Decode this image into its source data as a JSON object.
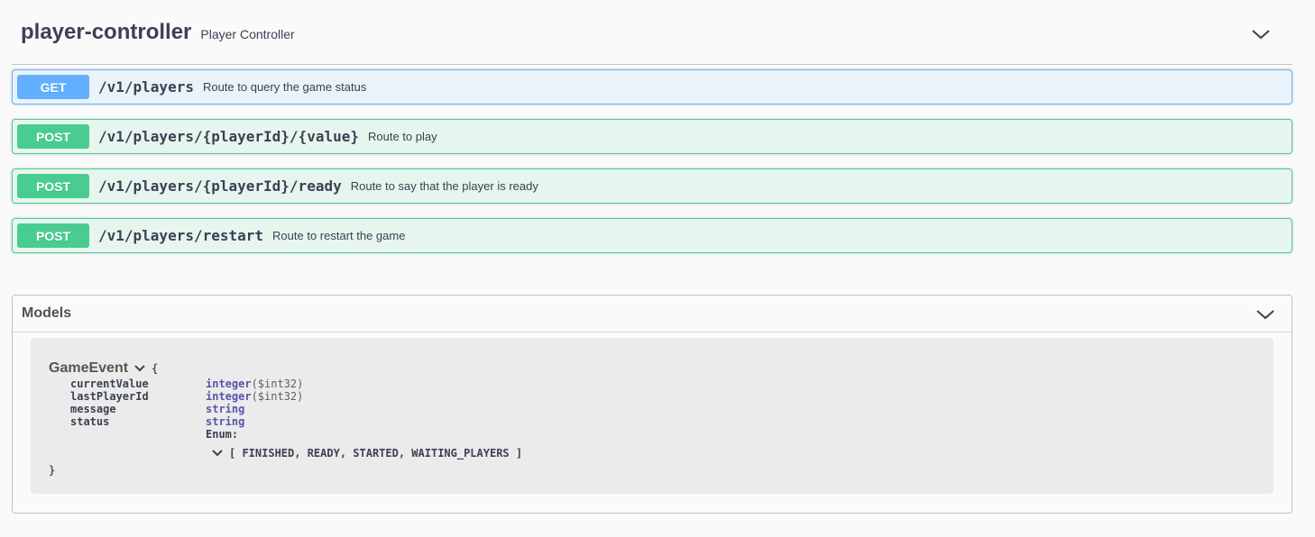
{
  "tag": {
    "name": "player-controller",
    "description": "Player Controller",
    "toggle_icon": "chevron-down-icon"
  },
  "operations": [
    {
      "method": "GET",
      "path": "/v1/players",
      "summary": "Route to query the game status"
    },
    {
      "method": "POST",
      "path": "/v1/players/{playerId}/{value}",
      "summary": "Route to play"
    },
    {
      "method": "POST",
      "path": "/v1/players/{playerId}/ready",
      "summary": "Route to say that the player is ready"
    },
    {
      "method": "POST",
      "path": "/v1/players/restart",
      "summary": "Route to restart the game"
    }
  ],
  "models": {
    "title": "Models",
    "toggle_icon": "chevron-down-icon",
    "model": {
      "name": "GameEvent",
      "open_brace": "{",
      "close_brace": "}",
      "properties": [
        {
          "name": "currentValue",
          "type": "integer",
          "format": "($int32)"
        },
        {
          "name": "lastPlayerId",
          "type": "integer",
          "format": "($int32)"
        },
        {
          "name": "message",
          "type": "string",
          "format": ""
        },
        {
          "name": "status",
          "type": "string",
          "format": ""
        }
      ],
      "enum_label": "Enum:",
      "enum_values": "[ FINISHED, READY, STARTED, WAITING_PLAYERS ]"
    }
  },
  "colors": {
    "get": "#61affe",
    "post": "#49cc90",
    "text": "#3b4151",
    "type": "#55a"
  }
}
